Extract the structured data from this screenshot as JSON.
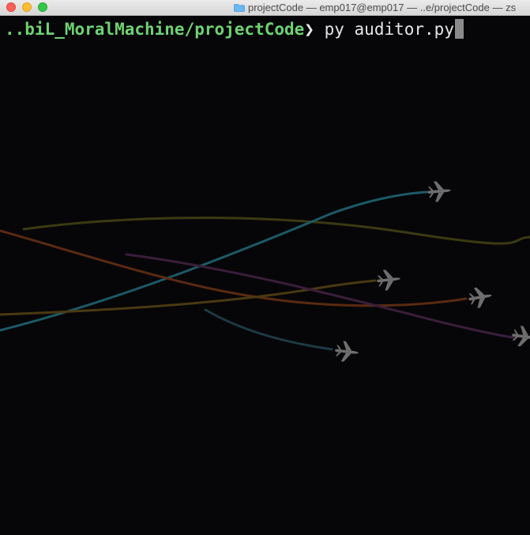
{
  "window": {
    "title": "projectCode — emp017@emp017 — ..e/projectCode — zs"
  },
  "terminal": {
    "prompt_path": "..biL_MoralMachine/projectCode",
    "prompt_arrow": "❯",
    "command": "py auditor.py"
  },
  "animation": {
    "trail_colors": [
      "#1c5a66",
      "#3a3a12",
      "#5a2a12",
      "#3a1e3a",
      "#1e3a44",
      "#4a3a12"
    ],
    "plane_color": "#6e6e6e",
    "plane_count": 5
  }
}
